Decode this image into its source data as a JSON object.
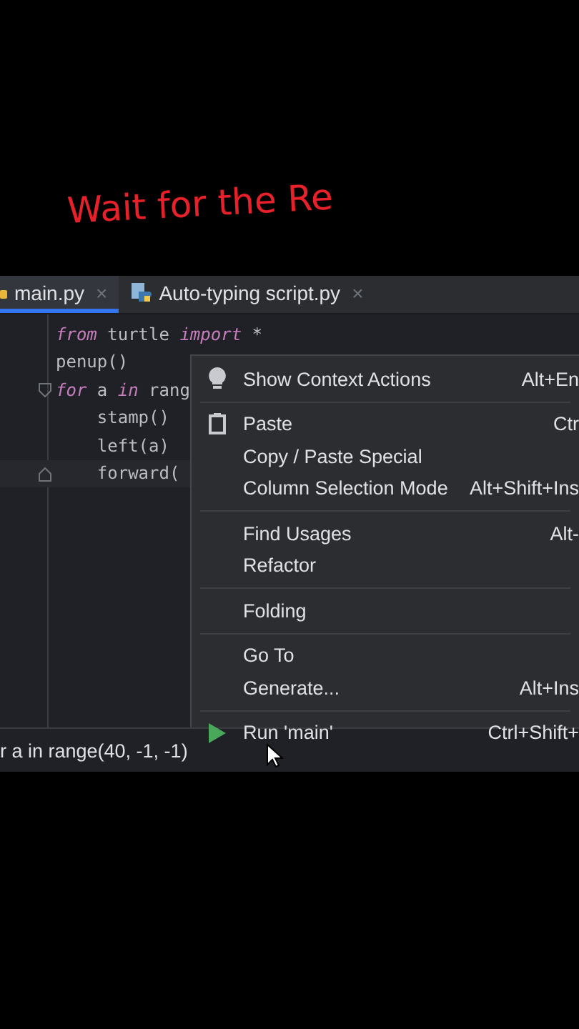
{
  "caption": "Wait for the Re",
  "tabs": [
    {
      "label": "main.py",
      "close": "×",
      "selected": true
    },
    {
      "label": "Auto-typing script.py",
      "close": "×",
      "selected": false
    }
  ],
  "code_lines": [
    {
      "fold": false,
      "current": false,
      "tokens": [
        {
          "kind": "keyword",
          "text": "from"
        },
        {
          "kind": "plain",
          "text": " turtle "
        },
        {
          "kind": "keyword",
          "text": "import"
        },
        {
          "kind": "plain",
          "text": " *"
        }
      ]
    },
    {
      "fold": false,
      "current": false,
      "tokens": [
        {
          "kind": "plain",
          "text": "penup()"
        }
      ]
    },
    {
      "fold": true,
      "current": false,
      "tokens": [
        {
          "kind": "keyword",
          "text": "for"
        },
        {
          "kind": "plain",
          "text": " a "
        },
        {
          "kind": "keyword",
          "text": "in"
        },
        {
          "kind": "plain",
          "text": " rang"
        }
      ]
    },
    {
      "fold": false,
      "current": false,
      "tokens": [
        {
          "kind": "plain",
          "text": "    stamp()"
        }
      ]
    },
    {
      "fold": false,
      "current": false,
      "tokens": [
        {
          "kind": "plain",
          "text": "    left(a)"
        }
      ]
    },
    {
      "fold": true,
      "current": true,
      "tokens": [
        {
          "kind": "plain",
          "text": "    forward("
        }
      ]
    }
  ],
  "breadcrumb": "r a in range(40, -1, -1)",
  "context_menu": [
    [
      {
        "kind": "bulb",
        "label": "Show Context Actions",
        "shortcut": "Alt+En"
      }
    ],
    [
      {
        "kind": "clipboard",
        "label": "Paste",
        "shortcut": "Ctr"
      },
      {
        "kind": "plain",
        "label": "Copy / Paste Special"
      },
      {
        "kind": "plain",
        "label": "Column Selection Mode",
        "shortcut": "Alt+Shift+Ins"
      }
    ],
    [
      {
        "kind": "plain",
        "label": "Find Usages",
        "shortcut": "Alt-"
      },
      {
        "kind": "plain",
        "label": "Refactor"
      }
    ],
    [
      {
        "kind": "plain",
        "label": "Folding"
      }
    ],
    [
      {
        "kind": "plain",
        "label": "Go To"
      },
      {
        "kind": "plain",
        "label": "Generate...",
        "shortcut": "Alt+Ins"
      }
    ],
    [
      {
        "kind": "run",
        "label": "Run 'main'",
        "shortcut": "Ctrl+Shift+"
      }
    ]
  ]
}
